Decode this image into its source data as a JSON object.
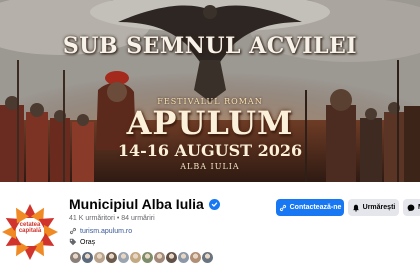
{
  "cover": {
    "title": "SUB SEMNUL ACVILEI",
    "festival_label": "FESTIVALUL ROMAN",
    "event_name": "APULUM",
    "dates": "14-16 AUGUST 2026",
    "city": "ALBA IULIA"
  },
  "avatar": {
    "line1": "cetatea",
    "line2": "capitală"
  },
  "profile": {
    "name": "Municipiul Alba Iulia",
    "verified": true,
    "stats": "41 K urmăritori • 84 urmăriri",
    "website": "turism.apulum.ro",
    "category": "Oraș",
    "follower_avatar_colors": [
      "#8a7f78",
      "#5d6a7c",
      "#b9a38c",
      "#6b5b4e",
      "#9aa5b1",
      "#c4a882",
      "#7d8d6a",
      "#a28a7a",
      "#5f5148",
      "#8c97a8",
      "#b08f75",
      "#6a7480"
    ]
  },
  "actions": {
    "contact_label": "Contactează-ne",
    "follow_label": "Urmărești",
    "message_label": "M"
  },
  "colors": {
    "primary": "#1877f2",
    "secondary_bg": "#e4e6eb",
    "avatar_red": "#d0342c",
    "avatar_orange": "#f08a24"
  }
}
